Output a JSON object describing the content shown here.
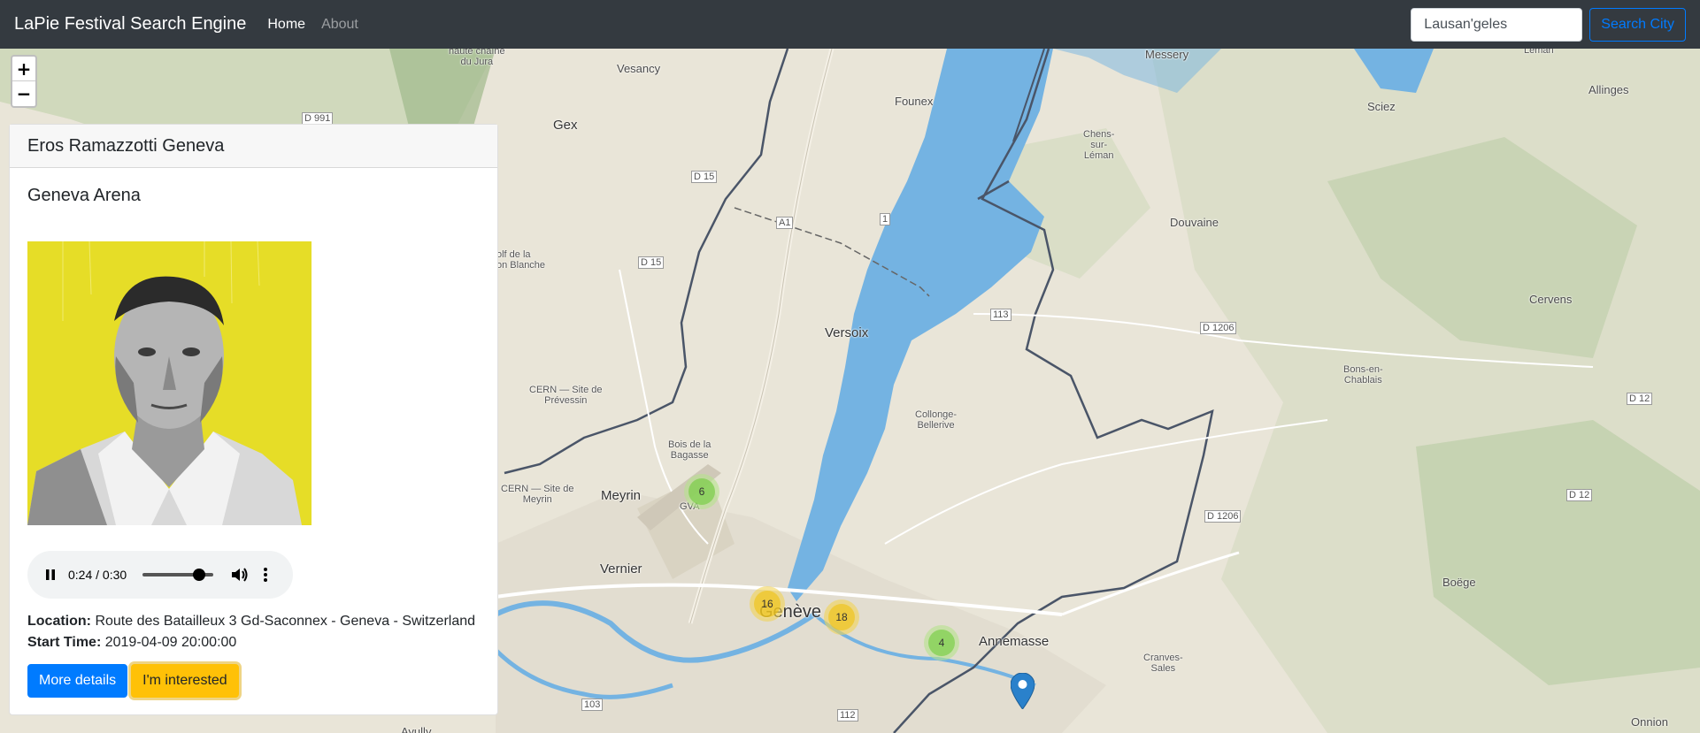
{
  "navbar": {
    "brand": "LaPie Festival Search Engine",
    "links": [
      "Home",
      "About"
    ],
    "search_value": "Lausan'geles",
    "search_button": "Search City"
  },
  "map": {
    "zoom_in": "+",
    "zoom_out": "−",
    "labels": {
      "vesancy": "Vesancy",
      "gex": "Gex",
      "founex": "Founex",
      "messery": "Messery",
      "chens": "Chens-\nsur-\nLéman",
      "sciez": "Sciez",
      "allinges": "Allinges",
      "leman": "Léman",
      "douvaine": "Douvaine",
      "cervens": "Cervens",
      "versoix": "Versoix",
      "collonge": "Collonge-\nBellerive",
      "bons": "Bons-en-\nChablais",
      "meyrin": "Meyrin",
      "vernier": "Vernier",
      "geneve": "Genève",
      "annemasse": "Annemasse",
      "cranves": "Cranves-\nSales",
      "boege": "Boëge",
      "onnion": "Onnion",
      "ayully": "Ayully",
      "cern1": "CERN — Site de\nPrévessin",
      "cern2": "CERN — Site de\nMeyrin",
      "bois": "Bois de la\nBagasse",
      "gva": "GVA",
      "haute": "haute chaîne\ndu Jura",
      "golf": "olf de la\non Blanche",
      "d991": "D 991",
      "d15a": "D 15",
      "d15b": "D 15",
      "a1": "A1",
      "r1": "1",
      "r113": "113",
      "d1206a": "D 1206",
      "d1206b": "D 1206",
      "d12a": "D 12",
      "d12b": "D 12",
      "r103": "103",
      "r112": "112"
    },
    "clusters": [
      "6",
      "16",
      "18",
      "4"
    ]
  },
  "event": {
    "title": "Eros Ramazzotti Geneva",
    "venue": "Geneva Arena",
    "audio_time": "0:24 / 0:30",
    "audio_progress": 0.8,
    "location_label": "Location:",
    "location": "Route des Batailleux 3 Gd-Saconnex - Geneva - Switzerland",
    "start_label": "Start Time:",
    "start_time": "2019-04-09 20:00:00",
    "more_details": "More details",
    "interested": "I'm interested"
  }
}
